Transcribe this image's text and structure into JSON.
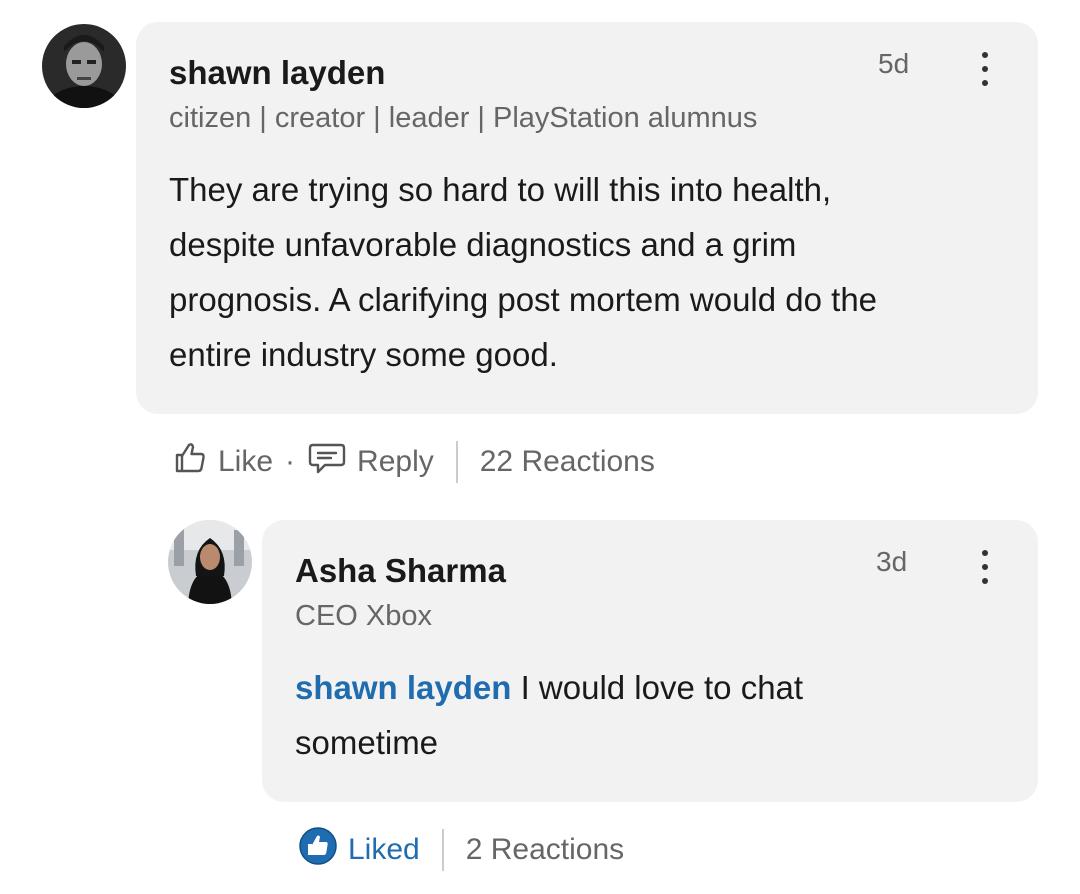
{
  "comment": {
    "author": "shawn layden",
    "headline": "citizen | creator | leader | PlayStation alumnus",
    "time": "5d",
    "lines": [
      "They are trying so hard to will this into health,",
      "despite unfavorable diagnostics and a grim",
      "prognosis. A clarifying post mortem would do the",
      "entire industry some good."
    ],
    "actions": {
      "like_label": "Like",
      "reply_label": "Reply",
      "reactions": "22 Reactions"
    }
  },
  "reply": {
    "author": "Asha Sharma",
    "headline": "CEO Xbox",
    "time": "3d",
    "mention": "shawn layden",
    "line1": "I would love to chat",
    "line2": "sometime",
    "actions": {
      "liked_label": "Liked",
      "reactions": "2 Reactions"
    }
  },
  "colors": {
    "bubble": "#f2f2f2",
    "link": "#1f6db0",
    "muted": "#666666"
  },
  "icons": [
    "avatar-shawn",
    "avatar-asha",
    "more-icon",
    "like-icon",
    "reply-icon",
    "liked-icon"
  ]
}
